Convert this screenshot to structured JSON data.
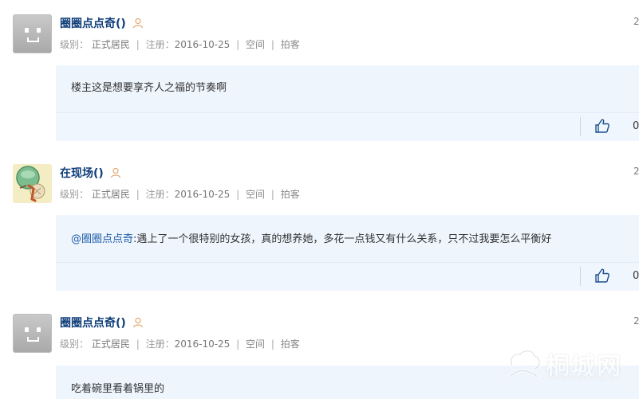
{
  "posts": [
    {
      "username": "圈圈点点奇()",
      "meta": {
        "level_label": "级别：",
        "level_value": "正式居民",
        "reg_label": "注册：",
        "reg_date": "2016-10-25",
        "link_space": "空间",
        "link_poke": "拍客"
      },
      "date_fragment": "2",
      "content": {
        "mention": "",
        "text": "楼主这是想要享齐人之福的节奏啊"
      },
      "like_count": "0"
    },
    {
      "username": "在现场()",
      "meta": {
        "level_label": "级别：",
        "level_value": "正式居民",
        "reg_label": "注册：",
        "reg_date": "2016-10-25",
        "link_space": "空间",
        "link_poke": "拍客"
      },
      "date_fragment": "2",
      "content": {
        "mention": "@圈圈点点奇",
        "text": ":遇上了一个很特别的女孩，真的想养她，多花一点钱又有什么关系，只不过我要怎么平衡好"
      },
      "like_count": "0"
    },
    {
      "username": "圈圈点点奇()",
      "meta": {
        "level_label": "级别：",
        "level_value": "正式居民",
        "reg_label": "注册：",
        "reg_date": "2016-10-25",
        "link_space": "空间",
        "link_poke": "拍客"
      },
      "date_fragment": "2",
      "content": {
        "mention": "",
        "text": "吃着碗里看着锅里的"
      },
      "like_count": ""
    }
  ],
  "separator": "|",
  "watermark": {
    "brand": "桐城网",
    "url": "www.tongcheng.cc"
  },
  "icons": {
    "user": "person-outline-icon",
    "like": "thumbs-up-icon"
  },
  "colors": {
    "username": "#0f3e7a",
    "mention": "#1c5aa8",
    "content_bg": "#eef5fd",
    "meta": "#999999"
  }
}
